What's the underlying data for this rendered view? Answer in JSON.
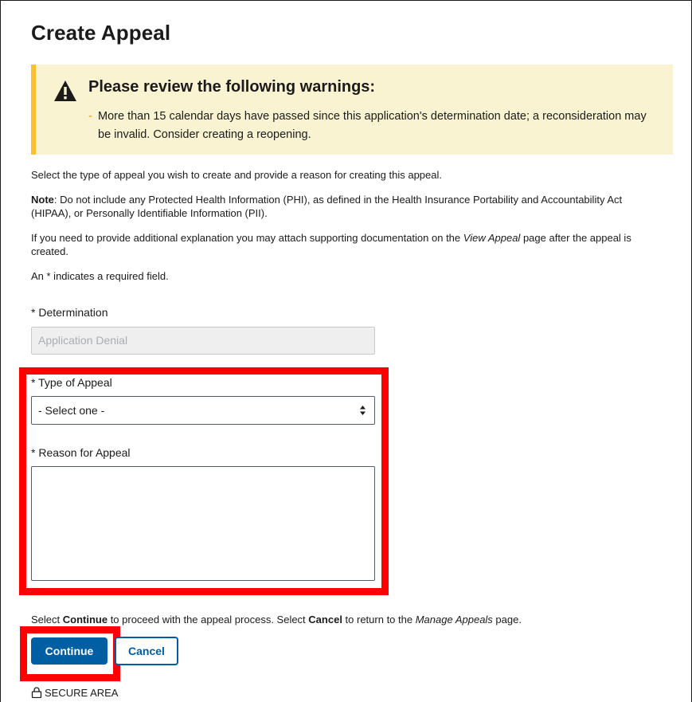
{
  "page": {
    "title": "Create Appeal"
  },
  "alert": {
    "icon": "warning-triangle-icon",
    "heading": "Please review the following warnings:",
    "bullet": "-",
    "items": [
      "More than 15 calendar days have passed since this application's determination date; a reconsideration may be invalid. Consider creating a reopening."
    ],
    "accent_color": "#ffbe2e",
    "background_color": "#faf3d1"
  },
  "instructions": {
    "intro": "Select the type of appeal you wish to create and provide a reason for creating this appeal.",
    "note_label": "Note",
    "note_text": ": Do not include any Protected Health Information (PHI), as defined in the Health Insurance Portability and Accountability Act (HIPAA), or Personally Identifiable Information (PII).",
    "attach_before": "If you need to provide additional explanation you may attach supporting documentation on the ",
    "attach_link": "View Appeal",
    "attach_after": " page after the appeal is created.",
    "required": "An * indicates a required field."
  },
  "form": {
    "determination_label": "* Determination",
    "determination_value": "Application Denial",
    "type_label": "* Type of Appeal",
    "type_selected": "- Select one -",
    "reason_label": "* Reason for Appeal",
    "reason_value": ""
  },
  "footer_text": {
    "t1": "Select ",
    "b1": "Continue",
    "t2": " to proceed with the appeal process. Select ",
    "b2": "Cancel",
    "t3": " to return to the ",
    "i1": "Manage Appeals",
    "t4": " page."
  },
  "buttons": {
    "continue": "Continue",
    "cancel": "Cancel"
  },
  "secure": {
    "icon": "lock-icon",
    "label": "SECURE AREA"
  },
  "colors": {
    "primary": "#005ea2",
    "highlight": "#ff0000"
  }
}
